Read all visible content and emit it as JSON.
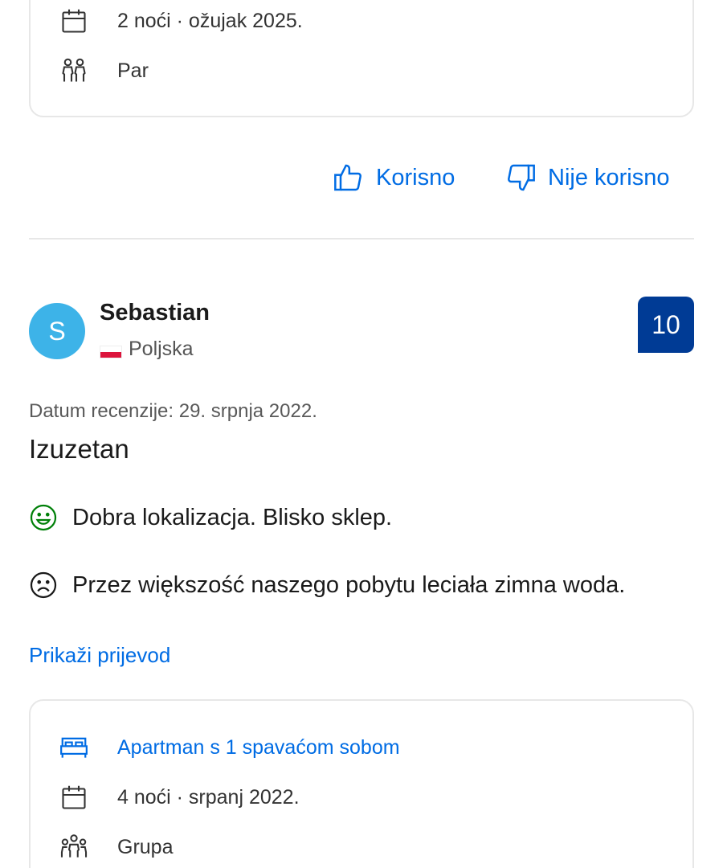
{
  "previous_review": {
    "stay": {
      "nights": "2 noći · ožujak 2025.",
      "traveler_type": "Par"
    },
    "feedback": {
      "helpful": "Korisno",
      "not_helpful": "Nije korisno"
    }
  },
  "review": {
    "reviewer": {
      "initial": "S",
      "name": "Sebastian",
      "country": "Poljska",
      "avatar_color": "#3db3e8"
    },
    "score": "10",
    "score_color": "#003b95",
    "date": "Datum recenzije: 29. srpnja 2022.",
    "title": "Izuzetan",
    "positive": "Dobra lokalizacja. Blisko sklep.",
    "negative": "Przez większość naszego pobytu leciała zimna woda.",
    "translate_link": "Prikaži prijevod",
    "stay": {
      "room": "Apartman s 1 spavaćom sobom",
      "nights": "4 noći · srpanj 2022.",
      "traveler_type": "Grupa"
    }
  },
  "colors": {
    "link": "#006ce4",
    "positive_icon": "#008009",
    "divider": "#e7e7e7"
  },
  "icons": [
    "calendar-icon",
    "couple-icon",
    "thumbs-up-icon",
    "thumbs-down-icon",
    "smile-icon",
    "frown-icon",
    "bed-icon",
    "group-icon"
  ]
}
